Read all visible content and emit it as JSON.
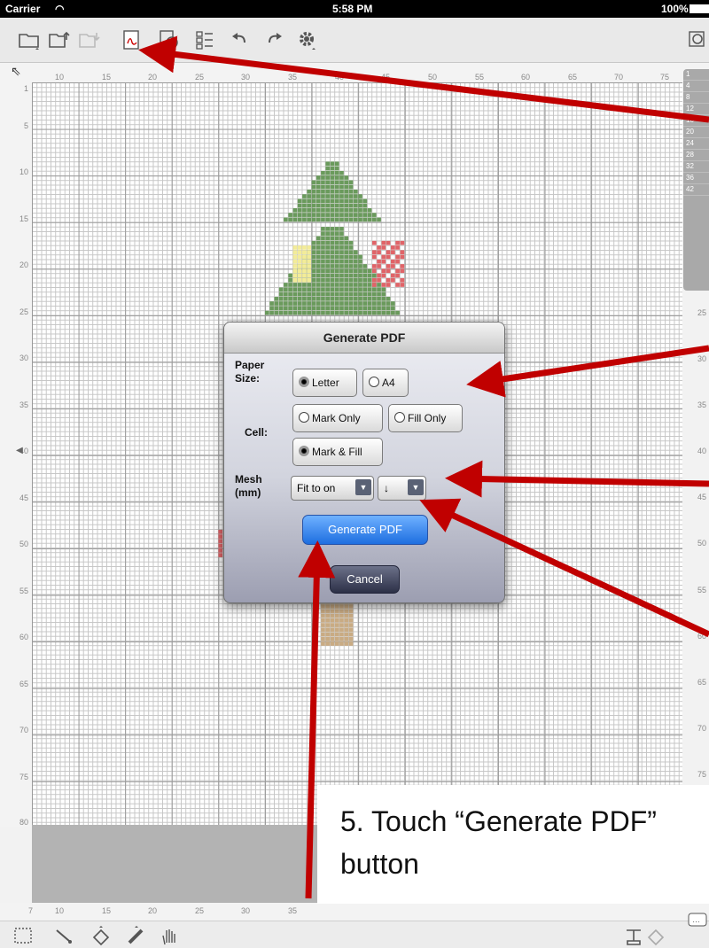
{
  "status_bar": {
    "carrier": "Carrier",
    "time": "5:58 PM",
    "battery": "100%"
  },
  "toolbar_icons": [
    "open-file-icon",
    "export-icon",
    "import-icon",
    "pdf-icon",
    "info-icon",
    "list-icon",
    "undo-icon",
    "redo-icon",
    "settings-gear-icon",
    "zoom-icon"
  ],
  "rulers": {
    "top": [
      "10",
      "15",
      "20",
      "25",
      "30",
      "35",
      "40",
      "45",
      "50",
      "55",
      "60",
      "65",
      "70",
      "75"
    ],
    "left": [
      "1",
      "5",
      "10",
      "15",
      "20",
      "25",
      "30",
      "35",
      "40",
      "45",
      "50",
      "55",
      "60",
      "65",
      "70",
      "75",
      "80"
    ],
    "right": [
      "25",
      "30",
      "35",
      "40",
      "45",
      "50",
      "55",
      "60",
      "65",
      "70",
      "75"
    ],
    "bottom": [
      "7",
      "10",
      "15",
      "20",
      "25",
      "30",
      "35"
    ]
  },
  "side_panel": [
    "1",
    "4",
    "8",
    "12",
    "16",
    "20",
    "24",
    "28",
    "32",
    "36",
    "42"
  ],
  "dialog": {
    "title": "Generate PDF",
    "paper_label": "Paper Size:",
    "paper_options": [
      {
        "label": "Letter",
        "selected": true
      },
      {
        "label": "A4",
        "selected": false
      }
    ],
    "cell_label": "Cell:",
    "cell_options": [
      {
        "label": "Mark Only",
        "selected": false
      },
      {
        "label": "Fill Only",
        "selected": false
      },
      {
        "label": "Mark & Fill",
        "selected": true
      }
    ],
    "mesh_label": "Mesh (mm)",
    "mesh_value": "Fit to on",
    "direction_value": "↓",
    "generate_label": "Generate PDF",
    "cancel_label": "Cancel"
  },
  "callout": {
    "line1": "5. Touch “Generate PDF”",
    "line2": "button"
  },
  "colors": {
    "arrow": "#c00000",
    "generate_button": "#1d6ee0",
    "cancel_button": "#2c3047",
    "green_cell": "#6a9a5c",
    "pink_cell": "#e06468",
    "yellow_cell": "#f3ec98",
    "tan_cell": "#c9ab83"
  }
}
